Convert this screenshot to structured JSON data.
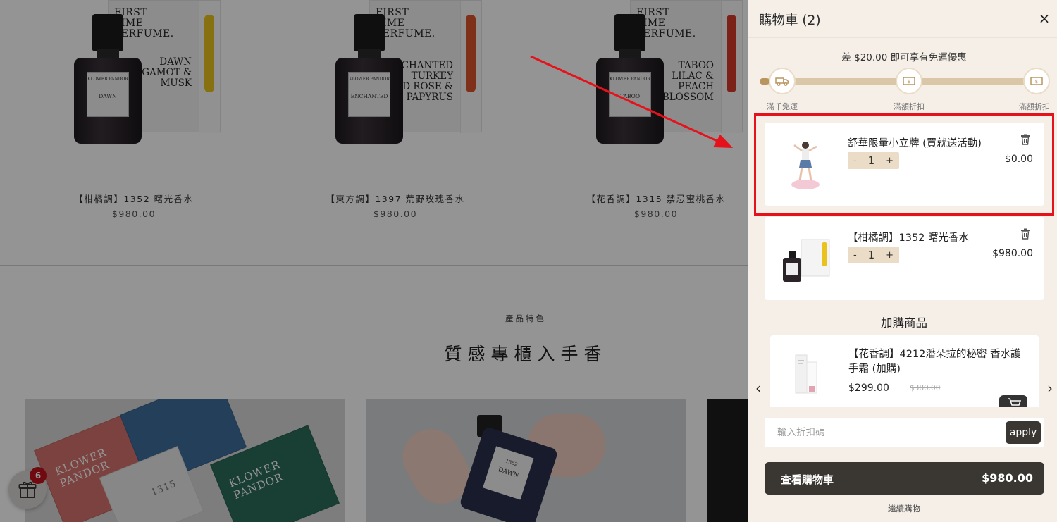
{
  "products": [
    {
      "box_head": [
        "FIRST",
        "TIME",
        "PERFUME."
      ],
      "box_name": [
        "DAWN",
        "BERGAMOT &",
        "MUSK"
      ],
      "label_brand": "KLOWER PANDOR",
      "label_name": "DAWN",
      "accent": "#e9c21b",
      "name": "【柑橘調】1352 曙光香水",
      "price": "$980.00"
    },
    {
      "box_head": [
        "FIRST",
        "TIME",
        "PERFUME."
      ],
      "box_name": [
        "ENCHANTED",
        "TURKEY",
        "RED ROSE &",
        "PAPYRUS"
      ],
      "label_brand": "KLOWER PANDOR",
      "label_name": "ENCHANTED",
      "accent": "#d9542a",
      "name": "【東方調】1397 荒野玫瑰香水",
      "price": "$980.00"
    },
    {
      "box_head": [
        "FIRST",
        "TIME",
        "PERFUME."
      ],
      "box_name": [
        "TABOO",
        "LILAC &",
        "PEACH",
        "BLOSSOM"
      ],
      "label_brand": "KLOWER PANDOR",
      "label_name": "TABOO",
      "accent": "#d63a2a",
      "name": "【花香調】1315 禁忌蜜桃香水",
      "price": "$980.00"
    }
  ],
  "features": {
    "label": "產品特色",
    "title": "質感專櫃入手香"
  },
  "photo1": {
    "box1": "KLOWER PANDOR",
    "box2": "KLOWER PANDOR",
    "box3_num": "1315"
  },
  "photo2": {
    "label_num": "1352",
    "label_name": "DAWN"
  },
  "gift": {
    "badge": "6"
  },
  "cart": {
    "title": "購物車 (2)",
    "close": "×",
    "free_shipping_msg": "差 $20.00 即可享有免運優惠",
    "progress": 0.03,
    "milestones": [
      "滿千免運",
      "滿額折扣",
      "滿額折扣"
    ],
    "items": [
      {
        "name": "舒華限量小立牌 (買就送活動)",
        "qty": "1",
        "minus": "-",
        "plus": "+",
        "price": "$0.00"
      },
      {
        "name": "【柑橘調】1352 曙光香水",
        "qty": "1",
        "minus": "-",
        "plus": "+",
        "price": "$980.00"
      }
    ],
    "upsell_title": "加購商品",
    "upsell": {
      "name": "【花香調】4212潘朵拉的秘密 香水護手霜 (加購)",
      "price": "$299.00",
      "original_price": "$380.00"
    },
    "prev_arrow": "‹",
    "next_arrow": "›",
    "coupon_placeholder": "輸入折扣碼",
    "apply_label": "apply",
    "checkout_label": "查看購物車",
    "checkout_total": "$980.00",
    "continue_label": "繼續購物"
  },
  "colors": {
    "accent": "#3a3631",
    "progress": "#b8955f",
    "highlight": "#e5121b"
  }
}
